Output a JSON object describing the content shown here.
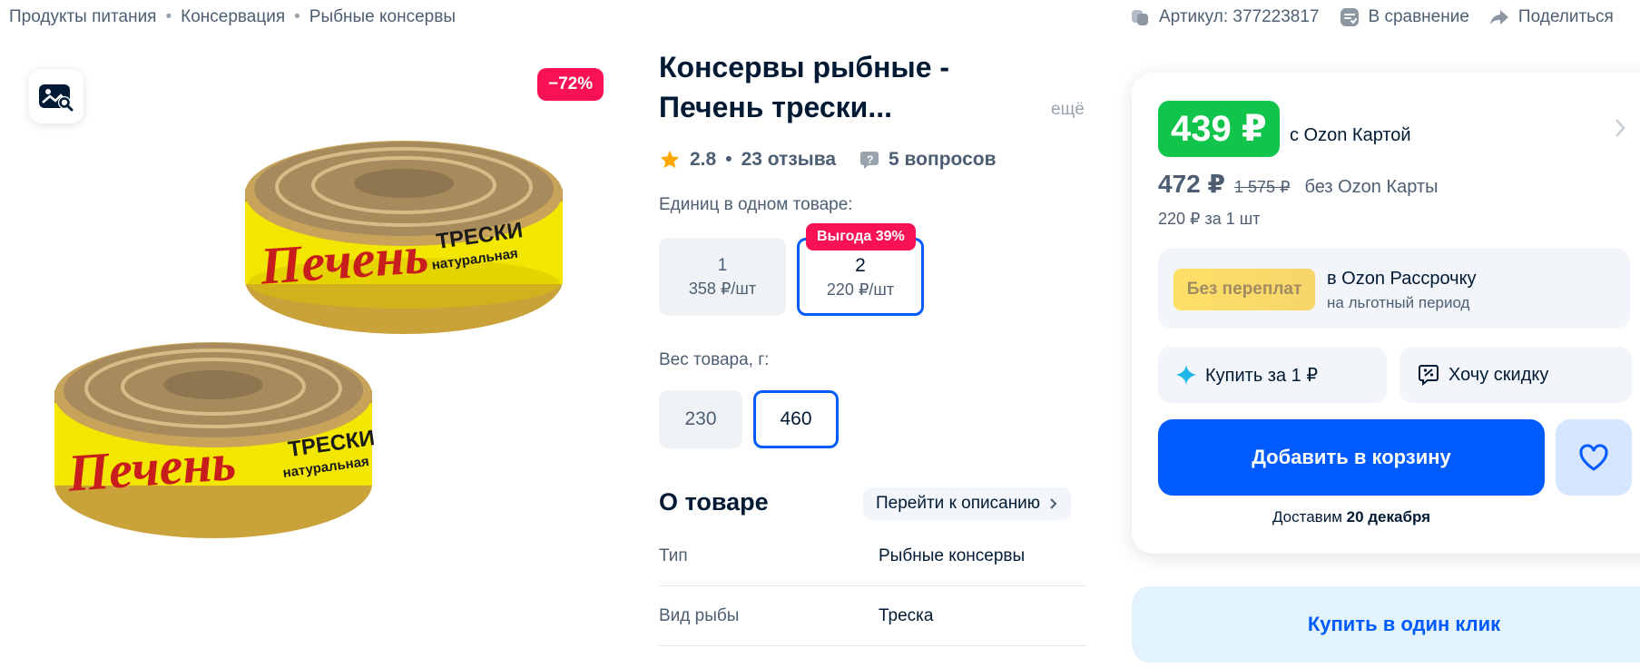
{
  "breadcrumb": [
    "Продукты питания",
    "Консервация",
    "Рыбные консервы"
  ],
  "top_actions": {
    "article": "Артикул: 377223817",
    "compare": "В сравнение",
    "share": "Поделиться"
  },
  "gallery": {
    "discount_badge": "−72%",
    "can_label_main": "Печень",
    "can_label_fish": "ТРЕСКИ",
    "can_label_sub": "натуральная"
  },
  "product": {
    "title": "Консервы рыбные - Печень трески...",
    "more": "ещё",
    "rating": "2.8",
    "reviews": "23 отзыва",
    "questions": "5 вопросов"
  },
  "units": {
    "label": "Единиц в одном товаре:",
    "benefit_badge": "Выгода 39%",
    "options": [
      {
        "count": "1",
        "price": "358 ₽/шт",
        "selected": false
      },
      {
        "count": "2",
        "price": "220 ₽/шт",
        "selected": true
      }
    ]
  },
  "weight": {
    "label": "Вес товара, г:",
    "options": [
      {
        "value": "230",
        "selected": false
      },
      {
        "value": "460",
        "selected": true
      }
    ]
  },
  "about": {
    "title": "О товаре",
    "goto": "Перейти к описанию",
    "specs": [
      {
        "key": "Тип",
        "value": "Рыбные консервы"
      },
      {
        "key": "Вид рыбы",
        "value": "Треска"
      }
    ]
  },
  "price": {
    "card_price": "439 ₽",
    "card_text": "с Ozon Картой",
    "regular_price": "472 ₽",
    "old_price": "1 575 ₽",
    "no_card_text": "без Ozon Карты",
    "per_unit": "220 ₽ за 1 шт",
    "installment_badge": "Без переплат",
    "installment_title": "в Ozon Рассрочку",
    "installment_sub": "на льготный период",
    "buy_for_1": "Купить за 1 ₽",
    "want_discount": "Хочу скидку",
    "add_to_cart": "Добавить в корзину",
    "delivery_prefix": "Доставим",
    "delivery_date": "20 декабря",
    "one_click": "Купить в один клик"
  },
  "colors": {
    "accent_blue": "#005bff",
    "price_green": "#10c44c",
    "discount_pink": "#f91155"
  }
}
